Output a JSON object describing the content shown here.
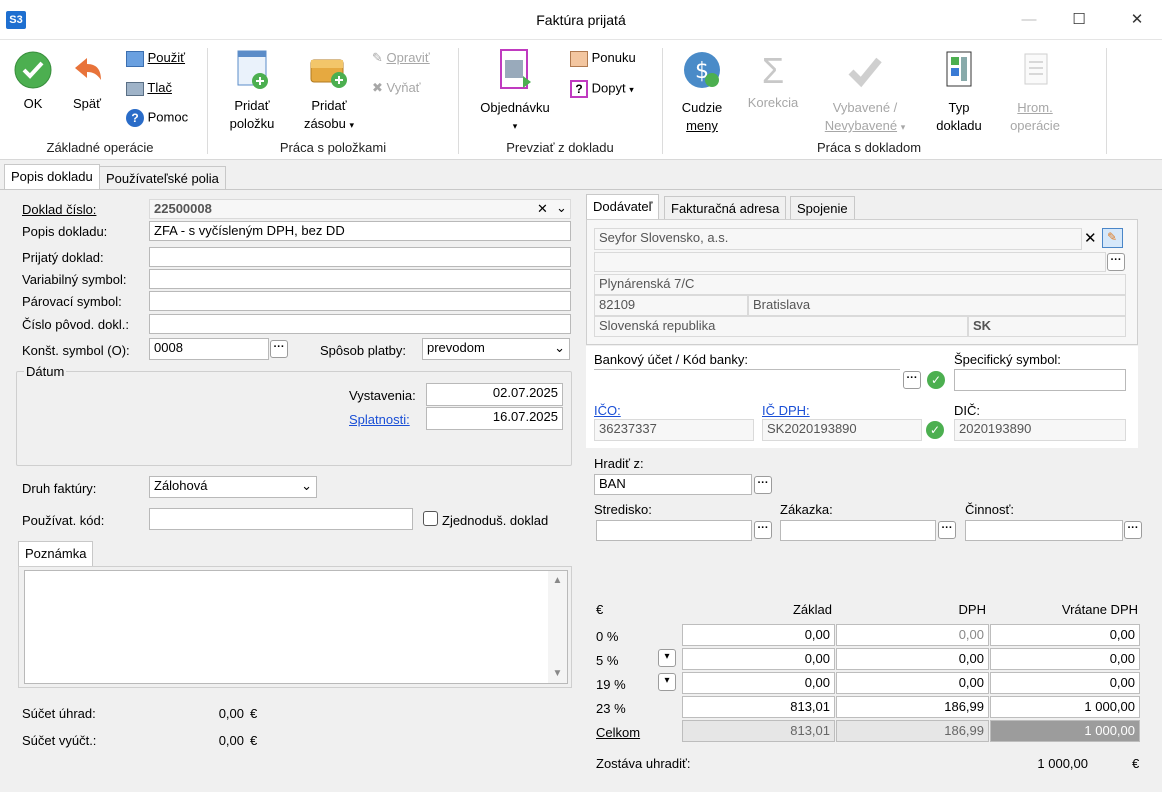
{
  "window": {
    "icon_text": "S3",
    "title": "Faktúra prijatá"
  },
  "ribbon": {
    "ok": "OK",
    "back": "Späť",
    "use": "Použiť",
    "print": "Tlač",
    "help": "Pomoc",
    "grp_basic": "Základné operácie",
    "add_item_1": "Pridať",
    "add_item_2": "položku",
    "add_stock_1": "Pridať",
    "add_stock_2": "zásobu",
    "edit": "Opraviť",
    "remove": "Vyňať",
    "grp_items": "Práca s položkami",
    "order": "Objednávku",
    "offer": "Ponuku",
    "demand": "Dopyt",
    "grp_take": "Prevziať z dokladu",
    "foreign_1": "Cudzie",
    "foreign_2": "meny",
    "correction": "Korekcia",
    "selected_1": "Vybavené /",
    "selected_2": "Nevybavené",
    "type_1": "Typ",
    "type_2": "dokladu",
    "bulk_1": "Hrom.",
    "bulk_2": "operácie",
    "grp_doc": "Práca s dokladom"
  },
  "tabs": {
    "description": "Popis dokladu",
    "user_fields": "Používateľské polia"
  },
  "form": {
    "doc_number_label": "Doklad číslo:",
    "doc_number": "22500008",
    "doc_desc_label": "Popis dokladu:",
    "doc_desc": "ZFA - s vyčísleným DPH, bez DD",
    "received_label": "Prijatý doklad:",
    "variable_label": "Variabilný symbol:",
    "pairing_label": "Párovací symbol:",
    "orig_label": "Číslo pôvod. dokl.:",
    "const_label": "Konšt. symbol (O):",
    "const_value": "0008",
    "payment_label": "Spôsob platby:",
    "payment_value": "prevodom",
    "date_group": "Dátum",
    "issue_label": "Vystavenia:",
    "issue_date": "02.07.2025",
    "due_label": "Splatnosti:",
    "due_date": "16.07.2025",
    "invoice_type_label": "Druh faktúry:",
    "invoice_type": "Zálohová",
    "user_code_label": "Používat. kód:",
    "simplified_label": "Zjednoduš. doklad",
    "note_tab": "Poznámka",
    "sum_pay_label": "Súčet úhrad:",
    "sum_pay": "0,00",
    "sum_bill_label": "Súčet vyúčt.:",
    "sum_bill": "0,00",
    "currency": "€"
  },
  "supplier": {
    "tab_supplier": "Dodávateľ",
    "tab_address": "Fakturačná adresa",
    "tab_contact": "Spojenie",
    "name": "Seyfor Slovensko, a.s.",
    "street": "Plynárenská 7/C",
    "zip": "82109",
    "city": "Bratislava",
    "country": "Slovenská republika",
    "country_code": "SK"
  },
  "bank": {
    "bank_label": "Bankový účet / Kód banky:",
    "specific_label": "Špecifický symbol:",
    "ico_label": "IČO:",
    "ico": "36237337",
    "icdph_label": "IČ DPH:",
    "icdph": "SK2020193890",
    "dic_label": "DIČ:",
    "dic": "2020193890",
    "pay_from_label": "Hradiť z:",
    "pay_from": "BAN",
    "center_label": "Stredisko:",
    "order_label": "Zákazka:",
    "activity_label": "Činnosť:"
  },
  "vat": {
    "currency": "€",
    "col_base": "Základ",
    "col_vat": "DPH",
    "col_total": "Vrátane DPH",
    "rows": [
      {
        "rate": "0 %",
        "base": "0,00",
        "vat": "0,00",
        "total": "0,00"
      },
      {
        "rate": "5 %",
        "base": "0,00",
        "vat": "0,00",
        "total": "0,00"
      },
      {
        "rate": "19 %",
        "base": "0,00",
        "vat": "0,00",
        "total": "0,00"
      },
      {
        "rate": "23 %",
        "base": "813,01",
        "vat": "186,99",
        "total": "1 000,00"
      }
    ],
    "sum_label": "Celkom",
    "sum_base": "813,01",
    "sum_vat": "186,99",
    "sum_total": "1 000,00",
    "remaining_label": "Zostáva uhradiť:",
    "remaining": "1 000,00",
    "remaining_currency": "€"
  }
}
